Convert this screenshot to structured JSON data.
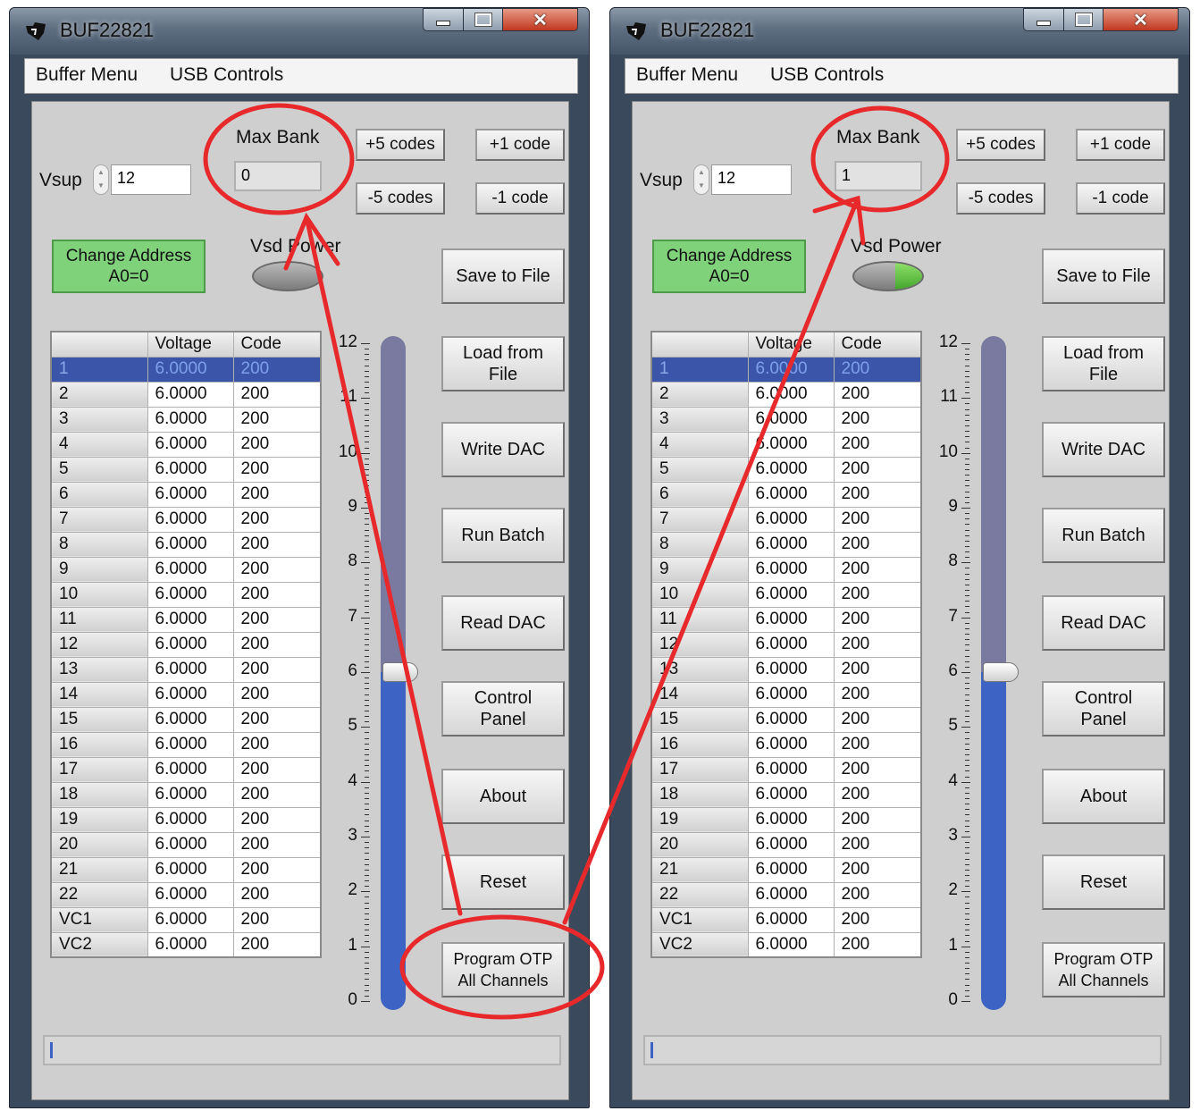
{
  "windows": [
    {
      "title": "BUF22821",
      "menu": [
        "Buffer Menu",
        "USB Controls"
      ],
      "vsup": {
        "label": "Vsup",
        "value": "12"
      },
      "max_bank": {
        "label": "Max Bank",
        "value": "0"
      },
      "code_buttons": [
        "+5 codes",
        "+1 code",
        "-5 codes",
        "-1 code"
      ],
      "change_address": "Change Address\nA0=0",
      "vsd_power": {
        "label": "Vsd Power",
        "on": false
      },
      "table": {
        "headers": [
          "",
          "Voltage",
          "Code"
        ],
        "selected_row": 0,
        "rows": [
          [
            "1",
            "6.0000",
            "200"
          ],
          [
            "2",
            "6.0000",
            "200"
          ],
          [
            "3",
            "6.0000",
            "200"
          ],
          [
            "4",
            "6.0000",
            "200"
          ],
          [
            "5",
            "6.0000",
            "200"
          ],
          [
            "6",
            "6.0000",
            "200"
          ],
          [
            "7",
            "6.0000",
            "200"
          ],
          [
            "8",
            "6.0000",
            "200"
          ],
          [
            "9",
            "6.0000",
            "200"
          ],
          [
            "10",
            "6.0000",
            "200"
          ],
          [
            "11",
            "6.0000",
            "200"
          ],
          [
            "12",
            "6.0000",
            "200"
          ],
          [
            "13",
            "6.0000",
            "200"
          ],
          [
            "14",
            "6.0000",
            "200"
          ],
          [
            "15",
            "6.0000",
            "200"
          ],
          [
            "16",
            "6.0000",
            "200"
          ],
          [
            "17",
            "6.0000",
            "200"
          ],
          [
            "18",
            "6.0000",
            "200"
          ],
          [
            "19",
            "6.0000",
            "200"
          ],
          [
            "20",
            "6.0000",
            "200"
          ],
          [
            "21",
            "6.0000",
            "200"
          ],
          [
            "22",
            "6.0000",
            "200"
          ],
          [
            "VC1",
            "6.0000",
            "200"
          ],
          [
            "VC2",
            "6.0000",
            "200"
          ]
        ]
      },
      "slider": {
        "ticks": [
          "12",
          "11",
          "10",
          "9",
          "8",
          "7",
          "6",
          "5",
          "4",
          "3",
          "2",
          "1",
          "0"
        ],
        "value": 6,
        "max": 12
      },
      "buttons": [
        "Save to File",
        "Load from\nFile",
        "Write DAC",
        "Run Batch",
        "Read DAC",
        "Control\nPanel",
        "About",
        "Reset",
        "Program OTP\nAll Channels"
      ]
    },
    {
      "title": "BUF22821",
      "menu": [
        "Buffer Menu",
        "USB Controls"
      ],
      "vsup": {
        "label": "Vsup",
        "value": "12"
      },
      "max_bank": {
        "label": "Max Bank",
        "value": "1"
      },
      "code_buttons": [
        "+5 codes",
        "+1 code",
        "-5 codes",
        "-1 code"
      ],
      "change_address": "Change Address\nA0=0",
      "vsd_power": {
        "label": "Vsd Power",
        "on": true
      },
      "table": {
        "headers": [
          "",
          "Voltage",
          "Code"
        ],
        "selected_row": 0,
        "rows": [
          [
            "1",
            "6.0000",
            "200"
          ],
          [
            "2",
            "6.0000",
            "200"
          ],
          [
            "3",
            "6.0000",
            "200"
          ],
          [
            "4",
            "6.0000",
            "200"
          ],
          [
            "5",
            "6.0000",
            "200"
          ],
          [
            "6",
            "6.0000",
            "200"
          ],
          [
            "7",
            "6.0000",
            "200"
          ],
          [
            "8",
            "6.0000",
            "200"
          ],
          [
            "9",
            "6.0000",
            "200"
          ],
          [
            "10",
            "6.0000",
            "200"
          ],
          [
            "11",
            "6.0000",
            "200"
          ],
          [
            "12",
            "6.0000",
            "200"
          ],
          [
            "13",
            "6.0000",
            "200"
          ],
          [
            "14",
            "6.0000",
            "200"
          ],
          [
            "15",
            "6.0000",
            "200"
          ],
          [
            "16",
            "6.0000",
            "200"
          ],
          [
            "17",
            "6.0000",
            "200"
          ],
          [
            "18",
            "6.0000",
            "200"
          ],
          [
            "19",
            "6.0000",
            "200"
          ],
          [
            "20",
            "6.0000",
            "200"
          ],
          [
            "21",
            "6.0000",
            "200"
          ],
          [
            "22",
            "6.0000",
            "200"
          ],
          [
            "VC1",
            "6.0000",
            "200"
          ],
          [
            "VC2",
            "6.0000",
            "200"
          ]
        ]
      },
      "slider": {
        "ticks": [
          "12",
          "11",
          "10",
          "9",
          "8",
          "7",
          "6",
          "5",
          "4",
          "3",
          "2",
          "1",
          "0"
        ],
        "value": 6,
        "max": 12
      },
      "buttons": [
        "Save to File",
        "Load from\nFile",
        "Write DAC",
        "Run Batch",
        "Read DAC",
        "Control\nPanel",
        "About",
        "Reset",
        "Program OTP\nAll Channels"
      ]
    }
  ],
  "annotation_color": "#e8292b"
}
